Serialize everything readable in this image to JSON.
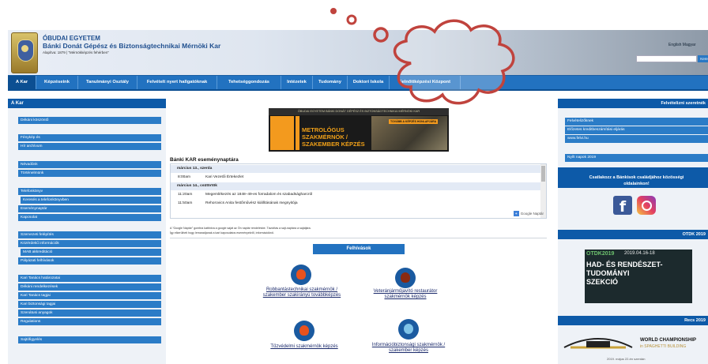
{
  "header": {
    "university": "ÓBUDAI EGYETEM",
    "faculty": "Bánki Donát Gépész és Biztonságtechnikai Mérnöki Kar",
    "founded": "Alapítva: 1879 | \"Mérnökképzés fehérben\"",
    "language": "English  Magyar",
    "search_placeholder": "",
    "search_button": "Keresés"
  },
  "nav": {
    "items": [
      {
        "label": "A Kar"
      },
      {
        "label": "Képzéseink"
      },
      {
        "label": "Tanulmányi Osztály"
      },
      {
        "label": "Felvételt nyert hallgatóknak"
      },
      {
        "label": "Tehetséggondozás"
      },
      {
        "label": "Intézetek"
      },
      {
        "label": "Tudomány"
      },
      {
        "label": "Doktori Iskola"
      },
      {
        "label": "Felnőttképzési Központ"
      }
    ]
  },
  "sidebar": {
    "title": "A Kar",
    "items": [
      {
        "label": "Dékáni köszöntő"
      },
      {
        "label": "Fénykép és"
      },
      {
        "label": "Hír archívum"
      },
      {
        "label": "Névadónk"
      },
      {
        "label": "Történelmünk"
      },
      {
        "label": "Telefonkönyv"
      },
      {
        "label": "Keresés a telefonkönyvben"
      },
      {
        "label": "Eseménynaptár"
      },
      {
        "label": "Kapcsolat"
      },
      {
        "label": "Szervezeti felépítés"
      },
      {
        "label": "Közérdekű információk"
      },
      {
        "label": "MAB akkreditáció"
      },
      {
        "label": "Pályázati felhívások"
      },
      {
        "label": "Kari Tanács határozatai"
      },
      {
        "label": "Dékáni rendelkezések"
      },
      {
        "label": "Kari Tanács tagjai"
      },
      {
        "label": "Kari biztonsági tagjai"
      },
      {
        "label": "Szenátusi anyagok"
      },
      {
        "label": "Regulations"
      },
      {
        "label": "Sajtófigyelés"
      }
    ]
  },
  "banner": {
    "top": "ÓBUDAI EGYETEM BÁNKI DONÁT GÉPÉSZ ÉS BIZTONSÁGTECHNIKAI MÉRNÖKI KAR",
    "line1": "METROLÓGUS",
    "line2": "SZAKMÉRNÖK /",
    "line3": "SZAKEMBER KÉPZÉS",
    "link": "TOVÁBB A KÉPZÉS HONLAPJÁRA"
  },
  "calendar": {
    "title": "Bánki KAR eseménynaptára",
    "rows": [
      {
        "type": "date",
        "text": "március 13., szerda"
      },
      {
        "type": "event",
        "time": "8:00am",
        "text": "Kari Vezetői Értekezlet"
      },
      {
        "type": "date",
        "text": "március 14., csütörtök"
      },
      {
        "type": "event",
        "time": "11:20am",
        "text": "Megemlékezés az 1848–49-es forradalom és szabadságharcról"
      },
      {
        "type": "event",
        "time": "11:50am",
        "text": "Rehorovics Anita festőművész kiállításának megnyitója"
      }
    ],
    "google": "Google Naptár",
    "note1": "A \"Google Naptár\" gombra kattintva a google saját az Ön naptár rendelésbe. Távolítás a sajt-naptára a sajátjára.",
    "note2": "Így elkerülheti hogy lemaradjanak a kari kapcsolatos eseményekről, információkról."
  },
  "calls": {
    "title": "Felhívások",
    "items": [
      {
        "label": "Robbantástechnikai szakmérnök / szakember szakirányú továbbképzés"
      },
      {
        "label": "Veteránjárműjavító restaurátor szakmérnök képzés"
      },
      {
        "label": "Tűzvédelmi szakmérnök képzés"
      },
      {
        "label": "Információbiztonsági szakmérnök / szakember képzés"
      }
    ]
  },
  "right": {
    "apply_title": "Felvételizni szeretnék",
    "apply_items": [
      {
        "label": "Felvételizőknek"
      },
      {
        "label": "Előzetes kreditbeszámítási eljárás"
      },
      {
        "label": "www.felvi.hu"
      }
    ],
    "open_day": "Nyílt napok 2019",
    "join_line1": "Csatlakozz a Bánkisok családjához közösségi",
    "join_line2": "oldalainkon!",
    "otdk_title": "OTDK 2019",
    "otdk_year": "OTDK2019",
    "otdk_date": "2019.04.16-18",
    "otdk_l1": "HAD- ÉS RENDÉSZET-",
    "otdk_l2": "TUDOMÁNYI",
    "otdk_l3": "SZEKCIÓ",
    "recs_title": "Recs 2019",
    "recs_wc": "WORLD CHAMPIONSHIP",
    "recs_sub": "in SPAGHETTI BUILDING",
    "recs_date": "2019. május 22-én szerdán"
  },
  "colors": {
    "nav_blue": "#2272c0",
    "dark_blue": "#0d5aa8",
    "item_blue": "#2b7cc7",
    "cloud": "#c0433d"
  }
}
